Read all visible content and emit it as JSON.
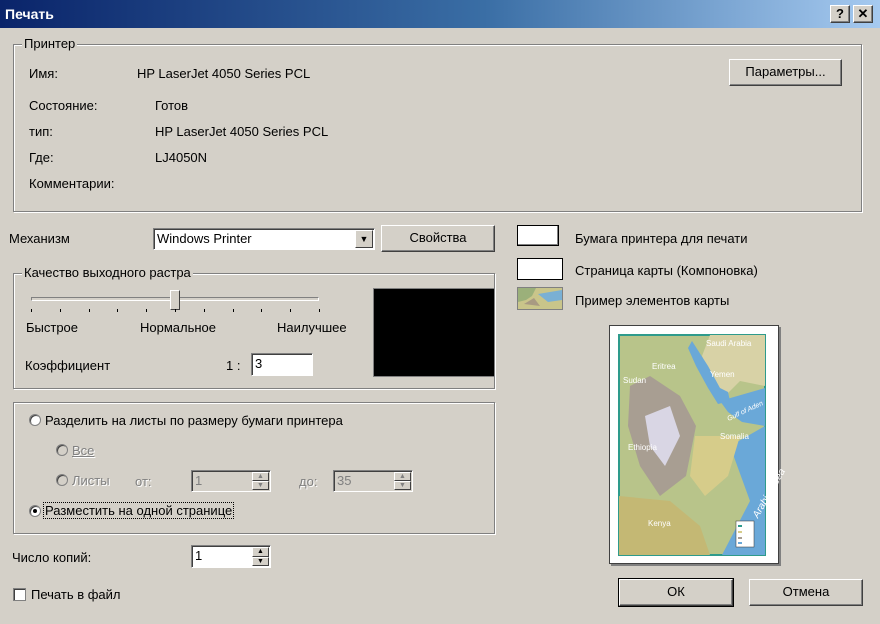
{
  "window": {
    "title": "Печать",
    "help_label": "?",
    "close_label": "✕"
  },
  "printer": {
    "group_title": "Принтер",
    "name_label": "Имя:",
    "name_value": "HP LaserJet 4050 Series PCL",
    "params_button": "Параметры...",
    "status_label": "Состояние:",
    "status_value": "Готов",
    "type_label": "тип:",
    "type_value": "HP LaserJet 4050 Series PCL",
    "where_label": "Где:",
    "where_value": "LJ4050N",
    "comment_label": "Комментарии:",
    "comment_value": ""
  },
  "engine": {
    "label": "Механизм",
    "selected": "Windows Printer",
    "properties_button": "Свойства"
  },
  "raster": {
    "group_title": "Качество выходного растра",
    "slider_left": "Быстрое",
    "slider_mid": "Нормальное",
    "slider_right": "Наилучшее",
    "slider_level": 0.5,
    "coef_label": "Коэффициент",
    "ratio_prefix": "1 :",
    "coef_value": "3"
  },
  "layout": {
    "tile_label": "Разделить на листы по размеру бумаги принтера",
    "all_label": "Все",
    "pages_label": "Листы",
    "from_label": "от:",
    "from_value": "1",
    "to_label": "до:",
    "to_value": "35",
    "fit_label": "Разместить на одной странице",
    "selected_option": "fit"
  },
  "copies": {
    "label": "Число копий:",
    "value": "1"
  },
  "print_to_file": {
    "label": "Печать в файл",
    "checked": false
  },
  "legend": {
    "paper_label": "Бумага принтера для печати",
    "page_label": "Страница карты (Компоновка)",
    "elements_label": "Пример элементов карты"
  },
  "preview_map": {
    "labels": [
      "Saudi Arabia",
      "Eritrea",
      "Yemen",
      "Sudan",
      "Gulf of Aden",
      "Somalia",
      "Ethiopia",
      "Kenya",
      "Arabian Sea"
    ]
  },
  "buttons": {
    "ok": "ОК",
    "cancel": "Отмена"
  },
  "colors": {
    "dialog_bg": "#d4d0c8",
    "title_bar": "#0a246a",
    "raster_preview": "#000000",
    "map_frame": "#2e9b8c"
  }
}
